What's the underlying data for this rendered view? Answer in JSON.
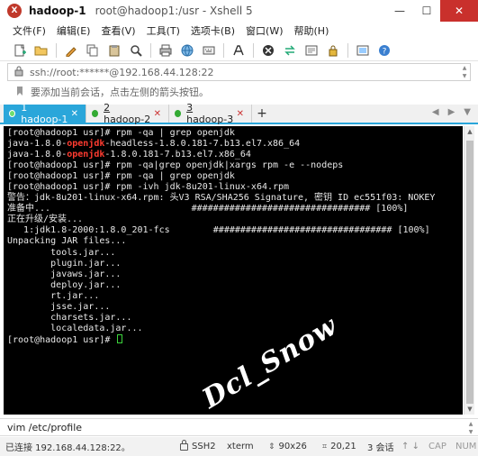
{
  "window": {
    "session_name": "hadoop-1",
    "path_and_app": "root@hadoop1:/usr - Xshell 5",
    "logo_text": "X",
    "minimize": "—",
    "maximize": "☐",
    "close": "✕"
  },
  "menu": [
    "文件(F)",
    "编辑(E)",
    "查看(V)",
    "工具(T)",
    "选项卡(B)",
    "窗口(W)",
    "帮助(H)"
  ],
  "toolbar": {
    "icons": [
      "new-session-icon",
      "open-folder-icon",
      "properties-icon",
      "copy-icon",
      "paste-icon",
      "find-icon",
      "print-icon",
      "globe-icon",
      "keyboard-icon",
      "font-icon",
      "xftp-icon",
      "transfer-icon",
      "compose-icon",
      "lock-icon",
      "fullscreen-icon",
      "help-icon"
    ]
  },
  "address": {
    "text": "ssh://root:******@192.168.44.128:22"
  },
  "hint": {
    "text": "要添加当前会话，点击左侧的箭头按钮。"
  },
  "tabs": [
    {
      "number": "1",
      "label": "hadoop-1",
      "active": true
    },
    {
      "number": "2",
      "label": "hadoop-2",
      "active": false
    },
    {
      "number": "3",
      "label": "hadoop-3",
      "active": false
    }
  ],
  "terminal": {
    "lines": [
      {
        "pre": "[root@hadoop1 usr]# rpm -qa | grep openjdk"
      },
      {
        "pre": "java-1.8.0-",
        "hl": "openjdk",
        "post": "-headless-1.8.0.181-7.b13.el7.x86_64"
      },
      {
        "pre": "java-1.8.0-",
        "hl": "openjdk",
        "post": "-1.8.0.181-7.b13.el7.x86_64"
      },
      {
        "pre": "[root@hadoop1 usr]# rpm -qa|grep openjdk|xargs rpm -e --nodeps"
      },
      {
        "pre": "[root@hadoop1 usr]# rpm -qa | grep openjdk"
      },
      {
        "pre": "[root@hadoop1 usr]# rpm -ivh jdk-8u201-linux-x64.rpm"
      },
      {
        "pre": "警告：jdk-8u201-linux-x64.rpm: 头V3 RSA/SHA256 Signature, 密钥 ID ec551f03: NOKEY"
      },
      {
        "pre": "准备中...                          ################################# [100%]"
      },
      {
        "pre": "正在升级/安装..."
      },
      {
        "pre": "   1:jdk1.8-2000:1.8.0_201-fcs        ################################# [100%]"
      },
      {
        "pre": "Unpacking JAR files..."
      },
      {
        "pre": "        tools.jar..."
      },
      {
        "pre": "        plugin.jar..."
      },
      {
        "pre": "        javaws.jar..."
      },
      {
        "pre": "        deploy.jar..."
      },
      {
        "pre": "        rt.jar..."
      },
      {
        "pre": "        jsse.jar..."
      },
      {
        "pre": "        charsets.jar..."
      },
      {
        "pre": "        localedata.jar..."
      },
      {
        "pre": "[root@hadoop1 usr]# ",
        "cursor": true
      }
    ],
    "watermark": "Dcl_Snow",
    "highlight_color": "#ff3b30",
    "cursor_color": "#3cd43c"
  },
  "compose": {
    "text": "vim /etc/profile"
  },
  "status": {
    "connection": "已连接 192.168.44.128:22。",
    "protocol": "SSH2",
    "terminal_type": "xterm",
    "size": "90x26",
    "cursor_pos": "20,21",
    "sessions": "3 会话",
    "caps": "CAP",
    "num": "NUM"
  },
  "colors": {
    "accent": "#2aa6da",
    "close_button": "#c9302c",
    "terminal_bg": "#000000"
  }
}
